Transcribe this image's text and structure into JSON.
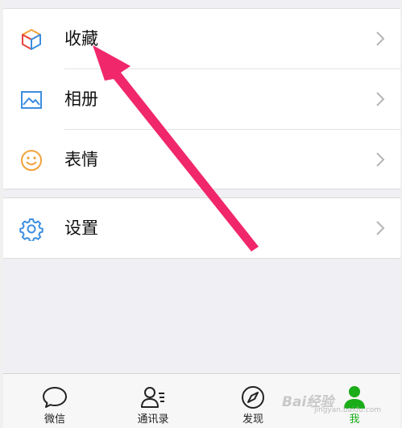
{
  "menu": {
    "favorites_label": "收藏",
    "album_label": "相册",
    "stickers_label": "表情",
    "settings_label": "设置"
  },
  "tabs": {
    "chats": "微信",
    "contacts": "通讯录",
    "discover": "发现",
    "me": "我"
  },
  "watermark": {
    "text": "Bai经验",
    "sub": "jingyan.baidu.com"
  },
  "icons": [
    "cube-icon",
    "picture-icon",
    "smiley-icon",
    "gear-icon",
    "chevron-right-icon",
    "chat-bubble-icon",
    "contacts-icon",
    "compass-icon",
    "person-icon"
  ],
  "colors": {
    "active_tab": "#1aad19",
    "annotation_arrow": "#f0276b",
    "album_icon": "#3d8ee0",
    "stickers_icon": "#f2a23a",
    "settings_icon": "#3d8ee0"
  }
}
